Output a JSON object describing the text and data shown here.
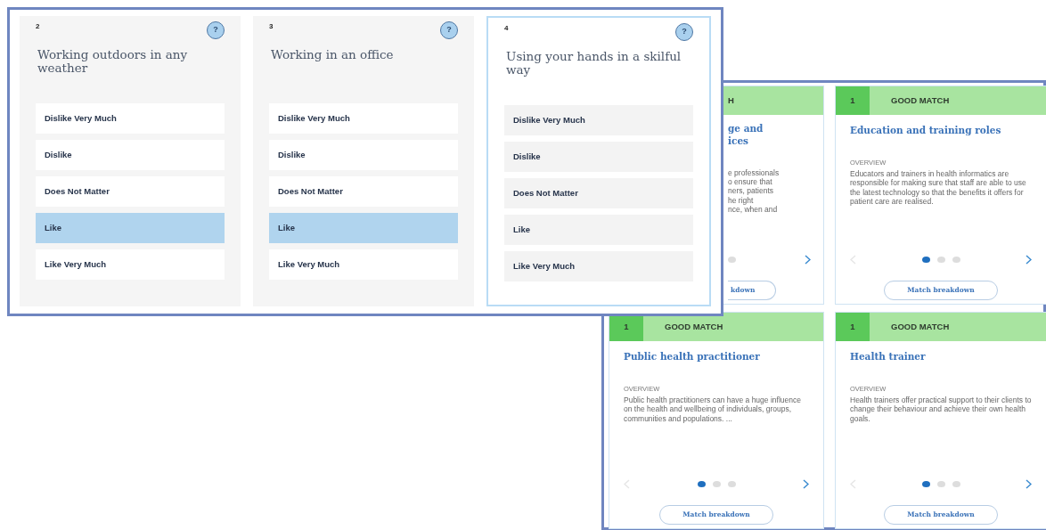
{
  "front_window": {
    "questions": [
      {
        "number": "2",
        "help": "?",
        "title": "Working outdoors in any weather",
        "active": false,
        "options": [
          {
            "label": "Dislike Very Much",
            "selected": false
          },
          {
            "label": "Dislike",
            "selected": false
          },
          {
            "label": "Does Not Matter",
            "selected": false
          },
          {
            "label": "Like",
            "selected": true
          },
          {
            "label": "Like Very Much",
            "selected": false
          }
        ]
      },
      {
        "number": "3",
        "help": "?",
        "title": "Working in an office",
        "active": false,
        "options": [
          {
            "label": "Dislike Very Much",
            "selected": false
          },
          {
            "label": "Dislike",
            "selected": false
          },
          {
            "label": "Does Not Matter",
            "selected": false
          },
          {
            "label": "Like",
            "selected": true
          },
          {
            "label": "Like Very Much",
            "selected": false
          }
        ]
      },
      {
        "number": "4",
        "help": "?",
        "title": "Using your hands in a skilful way",
        "active": true,
        "options": [
          {
            "label": "Dislike Very Much",
            "selected": false
          },
          {
            "label": "Dislike",
            "selected": false
          },
          {
            "label": "Does Not Matter",
            "selected": false
          },
          {
            "label": "Like",
            "selected": false
          },
          {
            "label": "Like Very Much",
            "selected": false
          }
        ]
      }
    ]
  },
  "back_window": {
    "cards": [
      {
        "kind": "partial",
        "match": "H",
        "title_lines": [
          "ge and",
          "ices"
        ],
        "description_lines": [
          "e professionals",
          "o ensure that",
          "ners, patients",
          "he right",
          "nce, when and"
        ],
        "dots": [
          {
            "selected": false
          }
        ],
        "button": "kdown"
      },
      {
        "kind": "full",
        "rank": "1",
        "match": "GOOD MATCH",
        "title": "Education and training roles",
        "overview_label": "OVERVIEW",
        "description": "Educators and trainers in health informatics are responsible for making sure that staff are able to use the latest technology so that the benefits it offers for patient care are realised.",
        "dots": [
          {
            "selected": true
          },
          {
            "selected": false
          },
          {
            "selected": false
          }
        ],
        "button": "Match breakdown"
      },
      {
        "kind": "full",
        "rank": "1",
        "match": "GOOD MATCH",
        "title": "Public health practitioner",
        "overview_label": "OVERVIEW",
        "description": "Public health practitioners can have a huge influence on the health and wellbeing of individuals, groups, communities and populations.  ...",
        "dots": [
          {
            "selected": true
          },
          {
            "selected": false
          },
          {
            "selected": false
          }
        ],
        "button": "Match breakdown"
      },
      {
        "kind": "full",
        "rank": "1",
        "match": "GOOD MATCH",
        "title": "Health trainer",
        "overview_label": "OVERVIEW",
        "description": "Health trainers offer practical support to their clients to change their behaviour and achieve their own health goals.",
        "dots": [
          {
            "selected": true
          },
          {
            "selected": false
          },
          {
            "selected": false
          }
        ],
        "button": "Match breakdown"
      }
    ]
  }
}
